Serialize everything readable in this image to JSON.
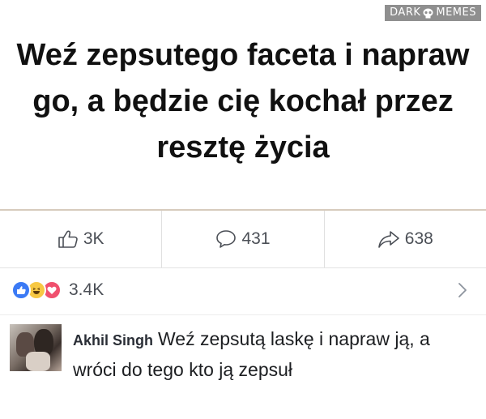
{
  "watermark": {
    "text_left": "DARK",
    "text_right": "MEMES",
    "icon": "skull-icon"
  },
  "post": {
    "headline": "Weź zepsutego faceta i napraw go, a będzie cię kochał przez resztę życia"
  },
  "stats": {
    "likes": {
      "icon": "thumbs-up-outline-icon",
      "label": "3K"
    },
    "comments": {
      "icon": "speech-bubble-icon",
      "label": "431"
    },
    "shares": {
      "icon": "share-arrow-icon",
      "label": "638"
    }
  },
  "reactions": {
    "icons": [
      "like-reaction-icon",
      "haha-reaction-icon",
      "love-reaction-icon"
    ],
    "count": "3.4K",
    "chevron_icon": "chevron-right-icon"
  },
  "comment": {
    "author": "Akhil Singh",
    "text": "Weź zepsutą laskę i napraw ją, a wróci do tego kto ją zepsuł",
    "avatar_icon": "avatar-photo"
  },
  "colors": {
    "like_blue": "#3b7af5",
    "haha_yellow": "#f7c843",
    "love_red": "#f0506e",
    "muted_text": "#4b4f56"
  }
}
